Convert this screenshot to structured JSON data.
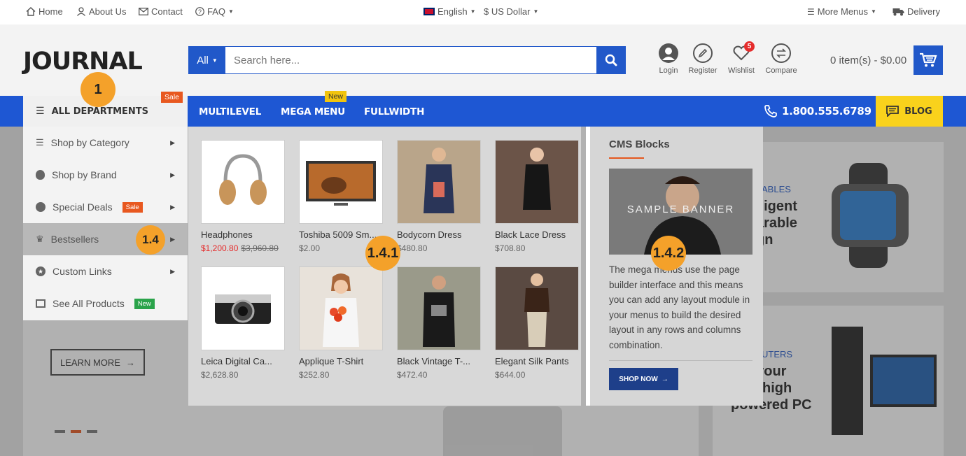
{
  "topbar": {
    "home": "Home",
    "about": "About Us",
    "contact": "Contact",
    "faq": "FAQ",
    "language": "English",
    "currency": "$ US Dollar",
    "more_menus": "More Menus",
    "delivery": "Delivery"
  },
  "header": {
    "logo": "JOURNAL",
    "search_category": "All",
    "search_placeholder": "Search here...",
    "login": "Login",
    "register": "Register",
    "wishlist": "Wishlist",
    "wishlist_count": "5",
    "compare": "Compare",
    "cart": "0 item(s) - $0.00"
  },
  "nav": {
    "all_departments": "ALL DEPARTMENTS",
    "sale_tag": "Sale",
    "multilevel": "MULTILEVEL",
    "mega_menu": "MEGA MENU",
    "new_tag": "New",
    "fullwidth": "FULLWIDTH",
    "phone": "1.800.555.6789",
    "blog": "BLOG"
  },
  "dept_menu": {
    "items": [
      {
        "label": "Shop by Category"
      },
      {
        "label": "Shop by Brand"
      },
      {
        "label": "Special Deals",
        "tag": "Sale"
      },
      {
        "label": "Bestsellers"
      },
      {
        "label": "Custom Links"
      },
      {
        "label": "See All Products",
        "tag": "New"
      }
    ]
  },
  "products": [
    {
      "name": "Headphones",
      "price": "$1,200.80",
      "old_price": "$3,960.80"
    },
    {
      "name": "Toshiba 5009 Sm...",
      "price": "$2.00"
    },
    {
      "name": "Bodycorn Dress",
      "price": "$480.80"
    },
    {
      "name": "Black Lace Dress",
      "price": "$708.80"
    },
    {
      "name": "Leica Digital Ca...",
      "price": "$2,628.80"
    },
    {
      "name": "Applique T-Shirt",
      "price": "$252.80"
    },
    {
      "name": "Black Vintage T-...",
      "price": "$472.40"
    },
    {
      "name": "Elegant Silk Pants",
      "price": "$644.00"
    }
  ],
  "cms": {
    "title": "CMS Blocks",
    "banner_text": "SAMPLE BANNER",
    "description": "The mega menus use the page builder interface and this means you can add any layout module in your menus to build the desired layout in any rows and columns combination.",
    "button": "SHOP NOW"
  },
  "background": {
    "learn_more": "LEARN MORE",
    "card1_cat": "ABLES",
    "card1_l1": "lligent",
    "card1_l2": "arable",
    "card1_l3": "gn",
    "card2_cat": "UTERS",
    "card2_l1": "l your",
    "card2_l2": "high",
    "card2_l3": "powered PC"
  },
  "markers": {
    "m1": "1",
    "m14": "1.4",
    "m141": "1.4.1",
    "m142": "1.4.2"
  },
  "colors": {
    "brand_blue": "#1e57d3",
    "accent_orange": "#e5581f",
    "blog_yellow": "#f9d21c",
    "marker_orange": "#f4a12a"
  }
}
